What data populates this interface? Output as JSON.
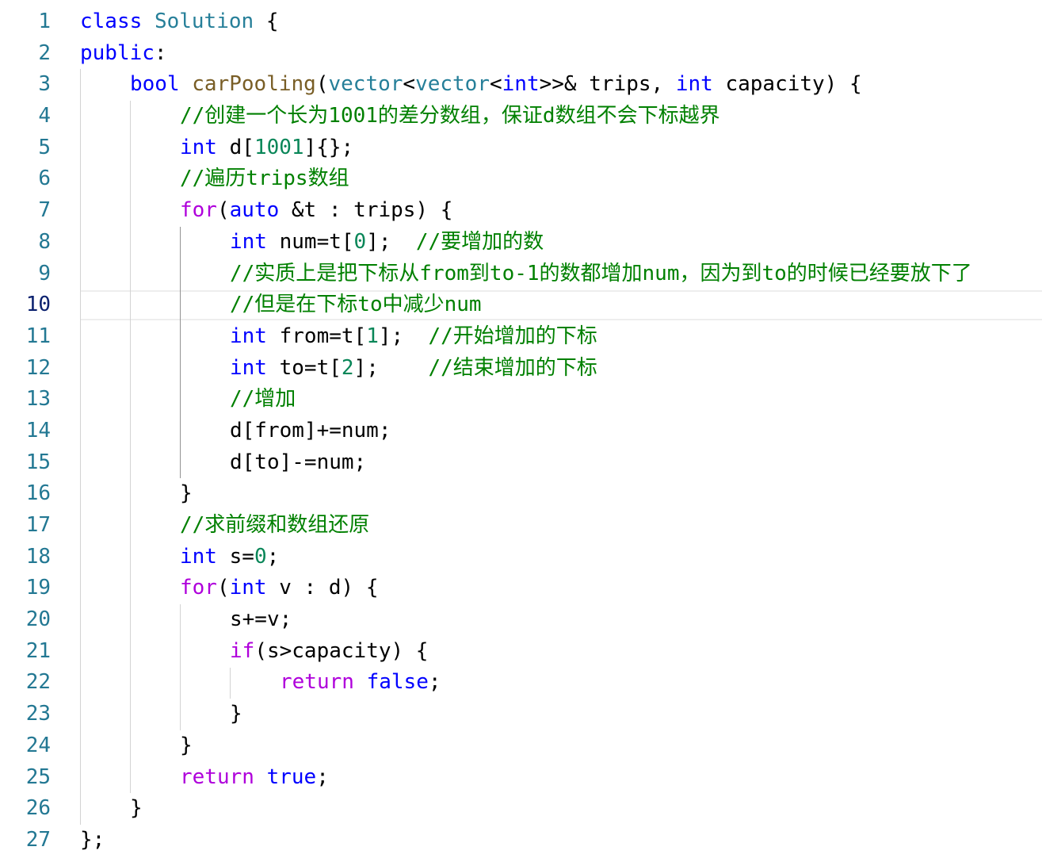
{
  "editor": {
    "language": "cpp",
    "current_line": 10,
    "colors": {
      "keyword": "#0000ff",
      "type": "#267f99",
      "function": "#795e26",
      "control": "#af00db",
      "number": "#098658",
      "comment": "#008000",
      "plain": "#000000",
      "line_number": "#237893",
      "line_number_active": "#0b216f"
    },
    "lines": [
      {
        "n": "1",
        "indent": 0,
        "tokens": [
          [
            "kw",
            "class"
          ],
          [
            "pl",
            " "
          ],
          [
            "ty",
            "Solution"
          ],
          [
            "pl",
            " {"
          ]
        ]
      },
      {
        "n": "2",
        "indent": 0,
        "tokens": [
          [
            "kw",
            "public"
          ],
          [
            "pl",
            ":"
          ]
        ]
      },
      {
        "n": "3",
        "indent": 1,
        "tokens": [
          [
            "kw",
            "bool"
          ],
          [
            "pl",
            " "
          ],
          [
            "fn",
            "carPooling"
          ],
          [
            "pl",
            "("
          ],
          [
            "ty",
            "vector"
          ],
          [
            "pl",
            "<"
          ],
          [
            "ty",
            "vector"
          ],
          [
            "pl",
            "<"
          ],
          [
            "kw",
            "int"
          ],
          [
            "pl",
            ">>& "
          ],
          [
            "pl",
            "trips"
          ],
          [
            "pl",
            ", "
          ],
          [
            "kw",
            "int"
          ],
          [
            "pl",
            " capacity) {"
          ]
        ]
      },
      {
        "n": "4",
        "indent": 2,
        "tokens": [
          [
            "cm",
            "//创建一个长为1001的差分数组，保证d数组不会下标越界"
          ]
        ]
      },
      {
        "n": "5",
        "indent": 2,
        "tokens": [
          [
            "kw",
            "int"
          ],
          [
            "pl",
            " d["
          ],
          [
            "num",
            "1001"
          ],
          [
            "pl",
            "]{};"
          ]
        ]
      },
      {
        "n": "6",
        "indent": 2,
        "tokens": [
          [
            "cm",
            "//遍历trips数组"
          ]
        ]
      },
      {
        "n": "7",
        "indent": 2,
        "tokens": [
          [
            "ctl",
            "for"
          ],
          [
            "pl",
            "("
          ],
          [
            "kw",
            "auto"
          ],
          [
            "pl",
            " &t : trips) {"
          ]
        ]
      },
      {
        "n": "8",
        "indent": 3,
        "tokens": [
          [
            "kw",
            "int"
          ],
          [
            "pl",
            " num=t["
          ],
          [
            "num",
            "0"
          ],
          [
            "pl",
            "];  "
          ],
          [
            "cm",
            "//要增加的数"
          ]
        ]
      },
      {
        "n": "9",
        "indent": 3,
        "tokens": [
          [
            "cm",
            "//实质上是把下标从from到to-1的数都增加num，因为到to的时候已经要放下了"
          ]
        ]
      },
      {
        "n": "10",
        "indent": 3,
        "tokens": [
          [
            "cm",
            "//但是在下标to中减少num"
          ]
        ]
      },
      {
        "n": "11",
        "indent": 3,
        "tokens": [
          [
            "kw",
            "int"
          ],
          [
            "pl",
            " from=t["
          ],
          [
            "num",
            "1"
          ],
          [
            "pl",
            "];  "
          ],
          [
            "cm",
            "//开始增加的下标"
          ]
        ]
      },
      {
        "n": "12",
        "indent": 3,
        "tokens": [
          [
            "kw",
            "int"
          ],
          [
            "pl",
            " to=t["
          ],
          [
            "num",
            "2"
          ],
          [
            "pl",
            "];    "
          ],
          [
            "cm",
            "//结束增加的下标"
          ]
        ]
      },
      {
        "n": "13",
        "indent": 3,
        "tokens": [
          [
            "cm",
            "//增加"
          ]
        ]
      },
      {
        "n": "14",
        "indent": 3,
        "tokens": [
          [
            "pl",
            "d[from]+=num;"
          ]
        ]
      },
      {
        "n": "15",
        "indent": 3,
        "tokens": [
          [
            "pl",
            "d[to]-=num;"
          ]
        ]
      },
      {
        "n": "16",
        "indent": 2,
        "tokens": [
          [
            "pl",
            "}"
          ]
        ]
      },
      {
        "n": "17",
        "indent": 2,
        "tokens": [
          [
            "cm",
            "//求前缀和数组还原"
          ]
        ]
      },
      {
        "n": "18",
        "indent": 2,
        "tokens": [
          [
            "kw",
            "int"
          ],
          [
            "pl",
            " s="
          ],
          [
            "num",
            "0"
          ],
          [
            "pl",
            ";"
          ]
        ]
      },
      {
        "n": "19",
        "indent": 2,
        "tokens": [
          [
            "ctl",
            "for"
          ],
          [
            "pl",
            "("
          ],
          [
            "kw",
            "int"
          ],
          [
            "pl",
            " v : d) {"
          ]
        ]
      },
      {
        "n": "20",
        "indent": 3,
        "tokens": [
          [
            "pl",
            "s+=v;"
          ]
        ]
      },
      {
        "n": "21",
        "indent": 3,
        "tokens": [
          [
            "ctl",
            "if"
          ],
          [
            "pl",
            "(s>capacity) {"
          ]
        ]
      },
      {
        "n": "22",
        "indent": 4,
        "tokens": [
          [
            "ctl",
            "return"
          ],
          [
            "pl",
            " "
          ],
          [
            "kw",
            "false"
          ],
          [
            "pl",
            ";"
          ]
        ]
      },
      {
        "n": "23",
        "indent": 3,
        "tokens": [
          [
            "pl",
            "}"
          ]
        ]
      },
      {
        "n": "24",
        "indent": 2,
        "tokens": [
          [
            "pl",
            "}"
          ]
        ]
      },
      {
        "n": "25",
        "indent": 2,
        "tokens": [
          [
            "ctl",
            "return"
          ],
          [
            "pl",
            " "
          ],
          [
            "kw",
            "true"
          ],
          [
            "pl",
            ";"
          ]
        ]
      },
      {
        "n": "26",
        "indent": 1,
        "tokens": [
          [
            "pl",
            "}"
          ]
        ]
      },
      {
        "n": "27",
        "indent": 0,
        "tokens": [
          [
            "pl",
            "};"
          ]
        ]
      }
    ]
  }
}
